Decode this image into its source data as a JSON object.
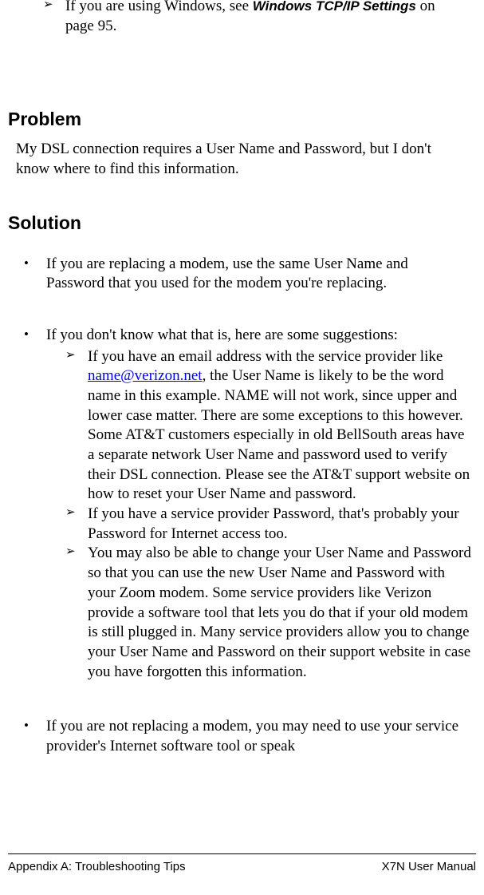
{
  "top_item": {
    "prefix": "If you are using Windows, see ",
    "bold": "Windows TCP/IP Settings",
    "suffix": " on page 95."
  },
  "problem": {
    "heading": "Problem",
    "text": "My DSL connection requires a User Name and Password, but I don't know where to find this information."
  },
  "solution": {
    "heading": "Solution",
    "b1": "If you are replacing a modem, use the same User Name and Password that you used for the modem you're replacing.",
    "b2": "If you don't know what that is, here are some suggestions:",
    "a1_pre": "If you have an email address with the service provider like ",
    "a1_link": "name@verizon.net",
    "a1_post": ", the User Name is likely to be the word name in this example. NAME will not work, since upper and lower case matter. There are some exceptions to this however. Some AT&T customers especially in old BellSouth areas have a separate network User Name and password used to verify their DSL connection. Please see the AT&T support website on how to reset your User Name and password.",
    "a2": "If you have a service provider Password, that's probably your Password for Internet access too.",
    "a3": "You may also be able to change your User Name and Password so that you can use the new User Name and Password with your Zoom modem. Some service providers like Verizon provide a software tool that lets you do that if your old modem is still plugged in. Many service providers allow you to change your User Name and Password on their support website in case you have forgotten this information.",
    "b3": "If you are not replacing a modem, you may need to use your service provider's Internet software tool or speak"
  },
  "footer": {
    "left": "Appendix A: Troubleshooting Tips",
    "right": "X7N User Manual"
  }
}
